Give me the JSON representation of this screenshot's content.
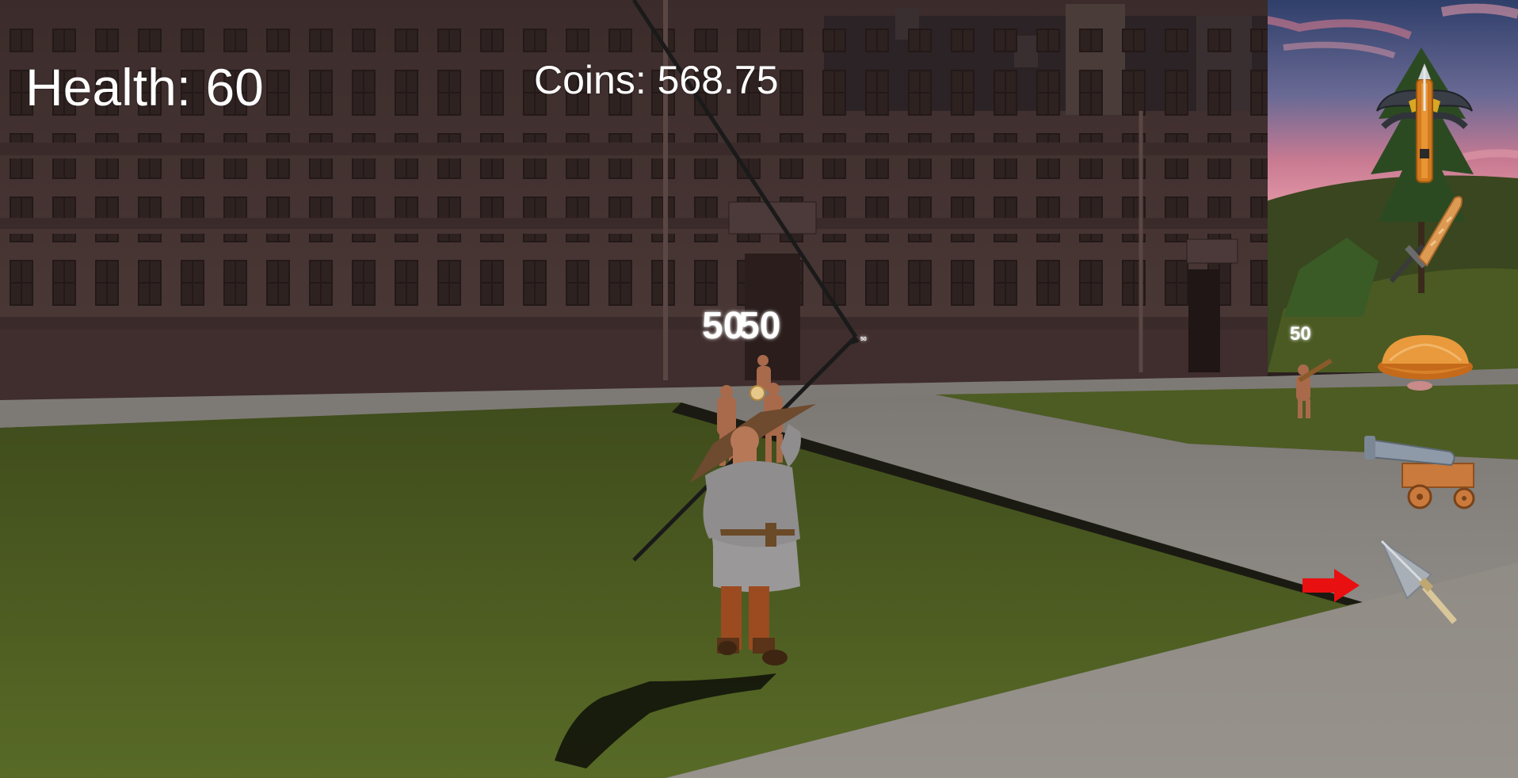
{
  "hud": {
    "health_text": "Health: 60",
    "coins_text": "Coins: 568.75"
  },
  "damage_popups": [
    "50",
    "50",
    "50",
    "50"
  ],
  "weapons": [
    {
      "name": "crossbow-icon"
    },
    {
      "name": "sword-icon"
    },
    {
      "name": "pie-icon"
    },
    {
      "name": "cannon-icon"
    },
    {
      "name": "spear-icon",
      "selected": true
    }
  ],
  "colors": {
    "hud_text": "#ffffff",
    "selector_arrow": "#e81010",
    "grass": "#4f5f22",
    "path": "#8a8782",
    "building": "#4a3735"
  }
}
